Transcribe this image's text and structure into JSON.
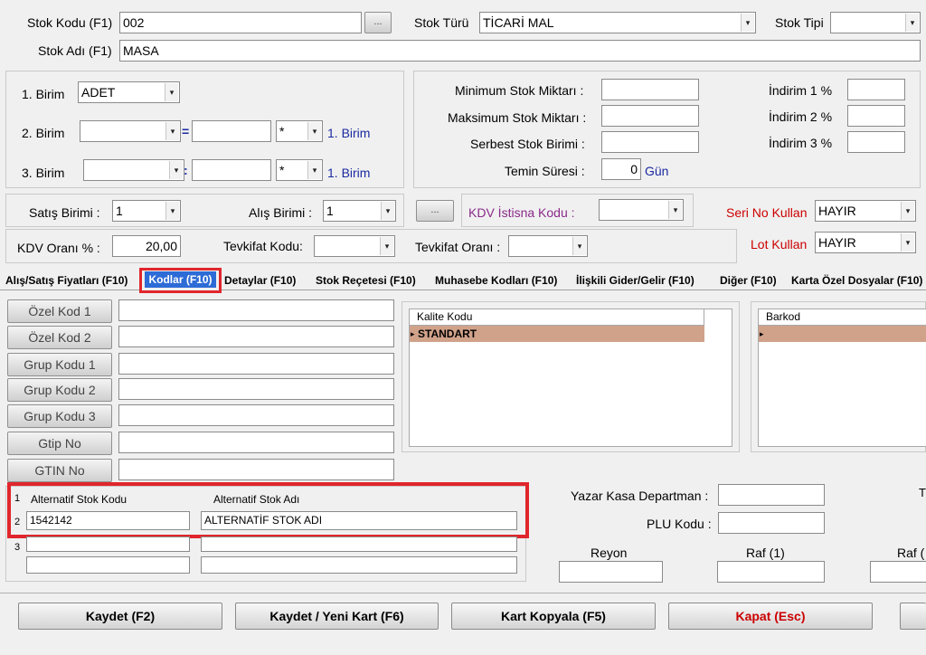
{
  "header": {
    "stok_kodu_label": "Stok Kodu (F1)",
    "stok_kodu_value": "002",
    "browse_button": "...",
    "stok_adi_label": "Stok Adı (F1)",
    "stok_adi_value": "MASA",
    "stok_turu_label": "Stok Türü",
    "stok_turu_value": "TİCARİ MAL",
    "stok_tipi_label": "Stok Tipi",
    "stok_tipi_value": ""
  },
  "units": {
    "birim1_label": "1. Birim",
    "birim1_value": "ADET",
    "birim2_label": "2. Birim",
    "birim3_label": "3. Birim",
    "equals": "=",
    "colon": ":",
    "multiplier": "*",
    "unit_ref": "1. Birim"
  },
  "limits": {
    "min_label": "Minimum Stok Miktarı :",
    "max_label": "Maksimum Stok Miktarı :",
    "serbest_label": "Serbest Stok Birimi :",
    "temin_label": "Temin Süresi :",
    "temin_value": "0",
    "temin_unit": "Gün",
    "ind1_label": "İndirim 1 %",
    "ind2_label": "İndirim 2 %",
    "ind3_label": "İndirim 3 %"
  },
  "pricing": {
    "satis_birimi_label": "Satış Birimi :",
    "satis_birimi_value": "1",
    "alis_birimi_label": "Alış Birimi :",
    "alis_birimi_value": "1",
    "kdv_istisna_button": "...",
    "kdv_istisna_label": "KDV İstisna Kodu :",
    "seri_no_label": "Seri No Kullan",
    "seri_no_value": "HAYIR",
    "kdv_orani_label": "KDV Oranı % :",
    "kdv_orani_value": "20,00",
    "tevkifat_kodu_label": "Tevkifat Kodu:",
    "tevkifat_orani_label": "Tevkifat Oranı :",
    "lot_label": "Lot Kullan",
    "lot_value": "HAYIR"
  },
  "tabs": [
    {
      "label": "Alış/Satış Fiyatları (F10)"
    },
    {
      "label": "Kodlar (F10)"
    },
    {
      "label": "Detaylar  (F10)"
    },
    {
      "label": "Stok Reçetesi  (F10)"
    },
    {
      "label": "Muhasebe Kodları (F10)"
    },
    {
      "label": "İlişkili Gider/Gelir  (F10)"
    },
    {
      "label": "Diğer (F10)"
    },
    {
      "label": "Karta Özel Dosyalar (F10)"
    }
  ],
  "codes": {
    "ozel_kod1": "Özel Kod 1",
    "ozel_kod2": "Özel Kod 2",
    "grup1": "Grup Kodu 1",
    "grup2": "Grup Kodu 2",
    "grup3": "Grup Kodu 3",
    "gtip": "Gtip No",
    "gtin": "GTIN No"
  },
  "kalite": {
    "header": "Kalite Kodu",
    "row1": "STANDART"
  },
  "barkod": {
    "header": "Barkod"
  },
  "alternatif": {
    "col1": "Alternatif Stok Kodu",
    "col2": "Alternatif Stok Adı",
    "rows": [
      {
        "num": "1",
        "code": "",
        "name": ""
      },
      {
        "num": "2",
        "code": "1542142",
        "name": "ALTERNATİF STOK ADI"
      },
      {
        "num": "3",
        "code": "",
        "name": ""
      }
    ]
  },
  "kasa": {
    "yazar_kasa_label": "Yazar Kasa Departman :",
    "plu_label": "PLU Kodu :",
    "reyon_label": "Reyon",
    "raf1_label": "Raf (1)",
    "raf2_label": "Raf (",
    "t_label": "T"
  },
  "footer": {
    "kaydet": "Kaydet (F2)",
    "kaydet_yeni": "Kaydet / Yeni Kart (F6)",
    "kopyala": "Kart Kopyala (F5)",
    "kapat": "Kapat (Esc)"
  },
  "colors": {
    "highlight_row": "#d1a28a",
    "red_frame": "#e0262c",
    "navy_text": "#1a2aa0",
    "purple_text": "#8a2a8a",
    "red_text": "#cc0000"
  }
}
